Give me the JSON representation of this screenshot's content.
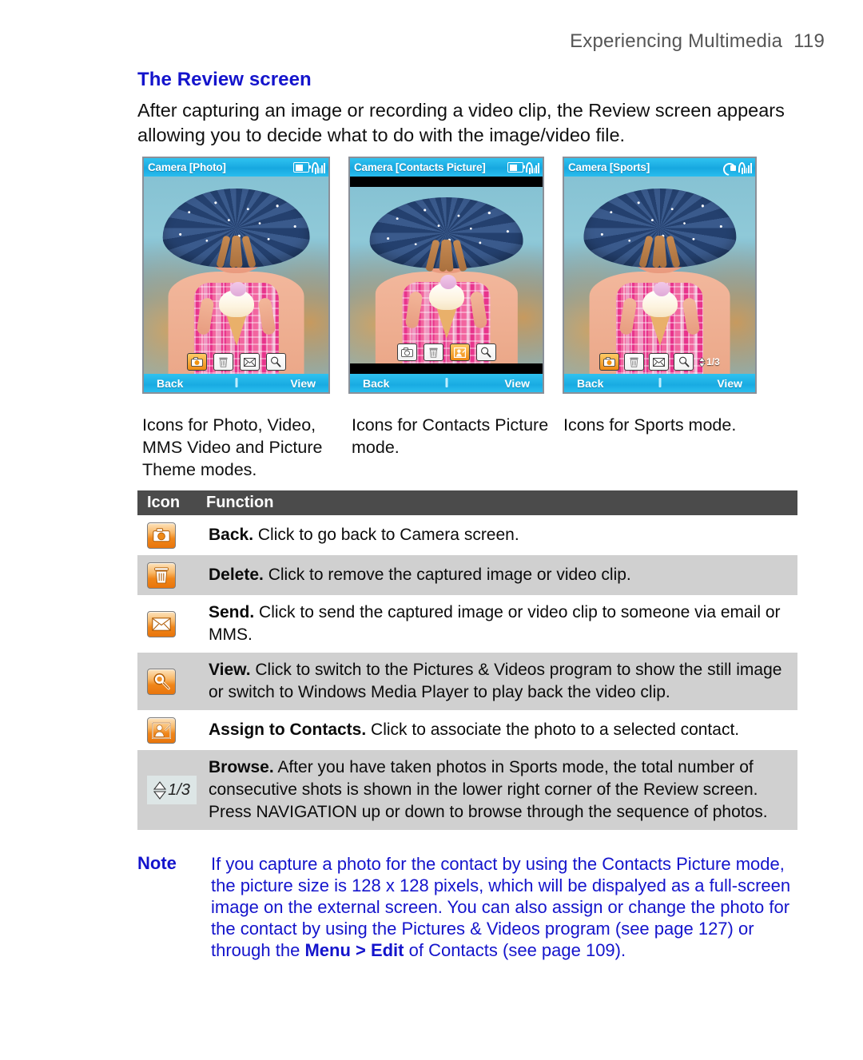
{
  "running_head": {
    "title": "Experiencing Multimedia",
    "page_number": "119"
  },
  "section": {
    "heading": "The Review screen",
    "intro": "After capturing an image or recording a video clip, the Review screen appears allowing you to decide what to do with the image/video file."
  },
  "screenshots": [
    {
      "title": "Camera [Photo]",
      "status_icons": [
        "battery-icon",
        "signal-icon"
      ],
      "letterboxed": false,
      "toolbar_icons": [
        "camera-icon",
        "trash-icon",
        "envelope-icon",
        "magnifier-icon"
      ],
      "selected_icon": "camera-icon",
      "browse_indicator": "",
      "softkey_left": "Back",
      "softkey_right": "View",
      "caption": "Icons for Photo, Video, MMS Video and Picture Theme modes."
    },
    {
      "title": "Camera [Contacts Picture]",
      "status_icons": [
        "battery-icon",
        "signal-icon"
      ],
      "letterboxed": true,
      "toolbar_icons": [
        "camera-icon",
        "trash-icon",
        "assign-contact-icon",
        "magnifier-icon"
      ],
      "selected_icon": "assign-contact-icon",
      "browse_indicator": "",
      "softkey_left": "Back",
      "softkey_right": "View",
      "caption": "Icons for Contacts Picture mode."
    },
    {
      "title": "Camera [Sports]",
      "status_icons": [
        "sync-icon",
        "signal-icon"
      ],
      "letterboxed": false,
      "toolbar_icons": [
        "camera-icon",
        "trash-icon",
        "envelope-icon",
        "magnifier-icon"
      ],
      "selected_icon": "camera-icon",
      "browse_indicator": "1/3",
      "softkey_left": "Back",
      "softkey_right": "View",
      "caption": "Icons for Sports mode."
    }
  ],
  "table": {
    "headers": {
      "icon": "Icon",
      "function": "Function"
    },
    "rows": [
      {
        "icon": "camera-icon",
        "term": "Back.",
        "description": " Click to go back to Camera screen."
      },
      {
        "icon": "trash-icon",
        "term": "Delete.",
        "description": " Click to remove the captured image or video clip."
      },
      {
        "icon": "envelope-icon",
        "term": "Send.",
        "description": " Click to send the captured image or video clip to someone via email or MMS."
      },
      {
        "icon": "magnifier-icon",
        "term": "View.",
        "description": " Click to switch to the Pictures & Videos program to show the still image or switch to Windows Media Player to play back the video clip."
      },
      {
        "icon": "assign-contact-icon",
        "term": "Assign to Contacts.",
        "description": " Click to associate the photo to a selected contact."
      },
      {
        "icon": "browse-icon",
        "icon_label": "1/3",
        "term": "Browse.",
        "description": " After you have taken photos in Sports mode, the total number of consecutive shots is shown in the lower right corner of the Review screen. Press NAVIGATION up or down to browse through the sequence of photos."
      }
    ]
  },
  "note": {
    "label": "Note",
    "text_part1": "If you capture a photo for the contact by using the Contacts Picture mode, the picture size is 128 x 128 pixels, which will be dispalyed as a full-screen image on the external screen. You can also assign or change the photo for the contact by using the Pictures & Videos program (see page 127) or through the ",
    "emphasis": "Menu > Edit",
    "text_part2": " of Contacts (see page 109)."
  },
  "colors": {
    "heading_blue": "#1414cc",
    "note_blue": "#1414cc",
    "table_header_gray": "#4b4b4b",
    "table_alt_row": "#d0d0d0",
    "titlebar_cyan": "#19abe2",
    "icon_orange": "#f0861a"
  }
}
